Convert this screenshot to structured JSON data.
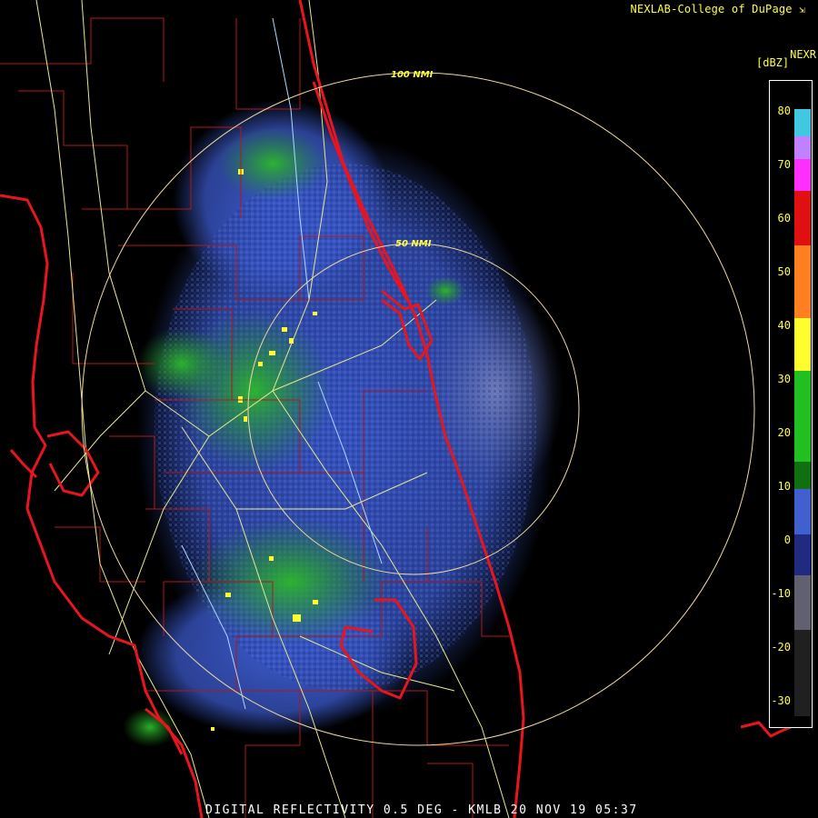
{
  "header": {
    "credit": "NEXLAB-College of DuPage",
    "product": "NEXR",
    "unit": "[dBZ]"
  },
  "footer": {
    "caption": "DIGITAL REFLECTIVITY 0.5 DEG - KMLB 20 NOV 19 05:37"
  },
  "range_rings": [
    {
      "label": "100 NMI"
    },
    {
      "label": "50 NMI"
    }
  ],
  "legend": {
    "ticks": [
      "80",
      "70",
      "60",
      "50",
      "40",
      "30",
      "20",
      "10",
      "0",
      "-10",
      "-20",
      "-30"
    ],
    "colors": {
      "cyan": "#40c8e0",
      "magenta": "#ff30ff",
      "red": "#e01010",
      "orange": "#ff8020",
      "yellow": "#ffff30",
      "green": "#20c020",
      "darkgreen": "#107010",
      "blue": "#4060d0",
      "navy": "#202a80",
      "gray": "#606070",
      "dark": "#202020"
    }
  },
  "map_colors": {
    "coast": "#e8141e",
    "county": "#b01818",
    "road": "#e8e890",
    "river": "#b0d8ff",
    "ring": "#f0d8a0"
  },
  "icons": {
    "credit_arrow": "diagonal-arrow-icon"
  }
}
